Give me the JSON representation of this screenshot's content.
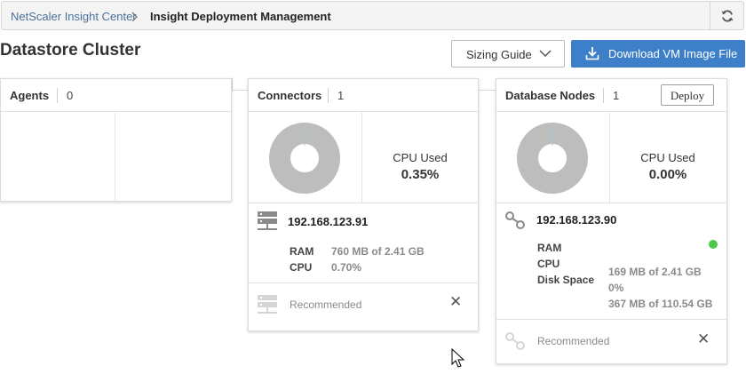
{
  "breadcrumb": {
    "root": "NetScaler Insight Center",
    "current": "Insight Deployment Management"
  },
  "page": {
    "title": "Datastore Cluster"
  },
  "toolbar": {
    "sizing_select_value": "Sizing Guide",
    "download_label": "Download VM Image File"
  },
  "agents": {
    "title": "Agents",
    "count": "0"
  },
  "connectors": {
    "title": "Connectors",
    "count": "1",
    "cpu_label": "CPU Used",
    "cpu_value": "0.35%",
    "node": {
      "ip": "192.168.123.91",
      "ram_key": "RAM",
      "ram_value": "760 MB of 2.41 GB",
      "cpu_key": "CPU",
      "cpu_value": "0.70%"
    },
    "recommended_label": "Recommended"
  },
  "database_nodes": {
    "title": "Database Nodes",
    "count": "1",
    "deploy_label": "Deploy",
    "cpu_label": "CPU Used",
    "cpu_value": "0.00%",
    "node": {
      "ip": "192.168.123.90",
      "ram_key": "RAM",
      "cpu_key": "CPU",
      "disk_key": "Disk Space",
      "ram_value": "169 MB of 2.41 GB",
      "cpu_value": "0%",
      "disk_value": "367 MB of 110.54 GB",
      "status": "up"
    },
    "recommended_label": "Recommended"
  },
  "colors": {
    "accent": "#3d7fc9",
    "link": "#4a6f9c",
    "status_ok": "#4cc84a",
    "donut": "#bdbdbd"
  }
}
